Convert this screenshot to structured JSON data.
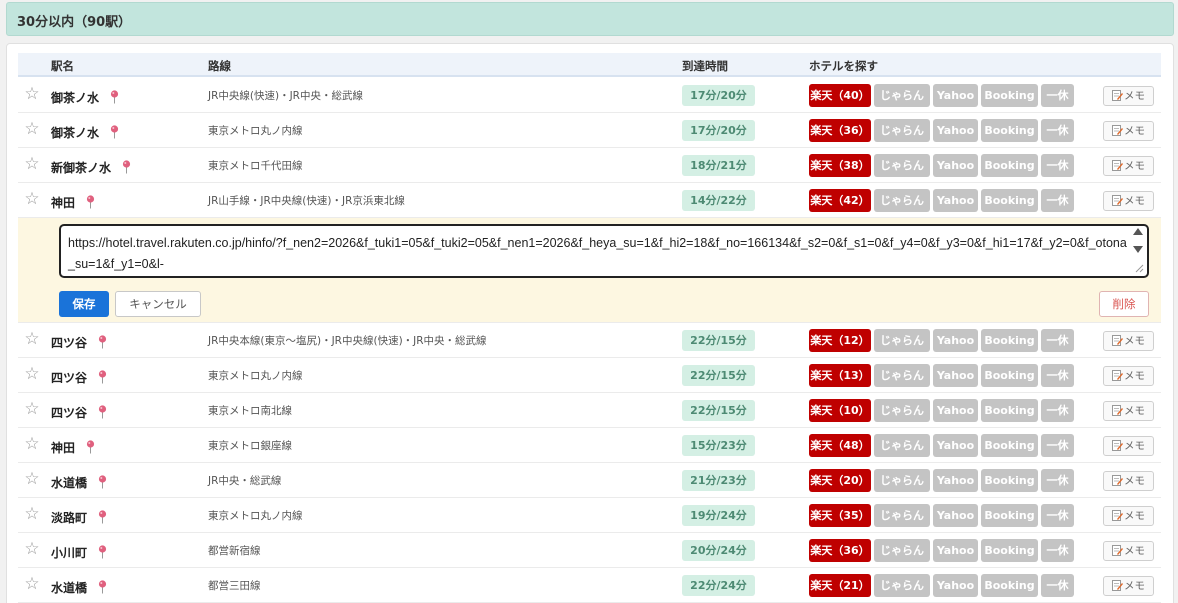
{
  "section": {
    "title": "30分以内（90駅）"
  },
  "table": {
    "headers": {
      "station": "駅名",
      "lines": "路線",
      "time": "到達時間",
      "hotels": "ホテルを探す"
    },
    "button_labels": {
      "jalan": "じゃらん",
      "yahoo": "Yahoo",
      "booking": "Booking",
      "ittai": "一休",
      "memo": "メモ"
    },
    "rows": [
      {
        "station": "御茶ノ水",
        "lines": "JR中央線(快速)・JR中央・総武線",
        "time": "17分/20分",
        "rakuten": "楽天（40）"
      },
      {
        "station": "御茶ノ水",
        "lines": "東京メトロ丸ノ内線",
        "time": "17分/20分",
        "rakuten": "楽天（36）"
      },
      {
        "station": "新御茶ノ水",
        "lines": "東京メトロ千代田線",
        "time": "18分/21分",
        "rakuten": "楽天（38）"
      },
      {
        "station": "神田",
        "lines": "JR山手線・JR中央線(快速)・JR京浜東北線",
        "time": "14分/22分",
        "rakuten": "楽天（42）"
      },
      {
        "station": "四ツ谷",
        "lines": "JR中央本線(東京～塩尻)・JR中央線(快速)・JR中央・総武線",
        "time": "22分/15分",
        "rakuten": "楽天（12）"
      },
      {
        "station": "四ツ谷",
        "lines": "東京メトロ丸ノ内線",
        "time": "22分/15分",
        "rakuten": "楽天（13）"
      },
      {
        "station": "四ツ谷",
        "lines": "東京メトロ南北線",
        "time": "22分/15分",
        "rakuten": "楽天（10）"
      },
      {
        "station": "神田",
        "lines": "東京メトロ銀座線",
        "time": "15分/23分",
        "rakuten": "楽天（48）"
      },
      {
        "station": "水道橋",
        "lines": "JR中央・総武線",
        "time": "21分/23分",
        "rakuten": "楽天（20）"
      },
      {
        "station": "淡路町",
        "lines": "東京メトロ丸ノ内線",
        "time": "19分/24分",
        "rakuten": "楽天（35）"
      },
      {
        "station": "小川町",
        "lines": "都営新宿線",
        "time": "20分/24分",
        "rakuten": "楽天（36）"
      },
      {
        "station": "水道橋",
        "lines": "都営三田線",
        "time": "22分/24分",
        "rakuten": "楽天（21）"
      }
    ]
  },
  "memo_editor": {
    "value": "https://hotel.travel.rakuten.co.jp/hinfo/?f_nen2=2026&f_tuki1=05&f_tuki2=05&f_nen1=2026&f_heya_su=1&f_hi2=18&f_no=166134&f_s2=0&f_s1=0&f_y4=0&f_y3=0&f_hi1=17&f_y2=0&f_otona_su=1&f_y1=0&l-",
    "save_label": "保存",
    "cancel_label": "キャンセル",
    "delete_label": "削除"
  },
  "colors": {
    "header_bg": "#c2e5dd",
    "rakuten_red": "#bf0000",
    "inactive_gray": "#c4c4c4",
    "time_badge_bg": "#d4efe4",
    "memo_panel_bg": "#fdf7e1",
    "save_blue": "#1a73d9",
    "pin_pink": "#e0607e"
  },
  "icons": {
    "star": "star-outline-icon",
    "pin": "map-pin-icon",
    "memo": "memo-pencil-icon"
  }
}
